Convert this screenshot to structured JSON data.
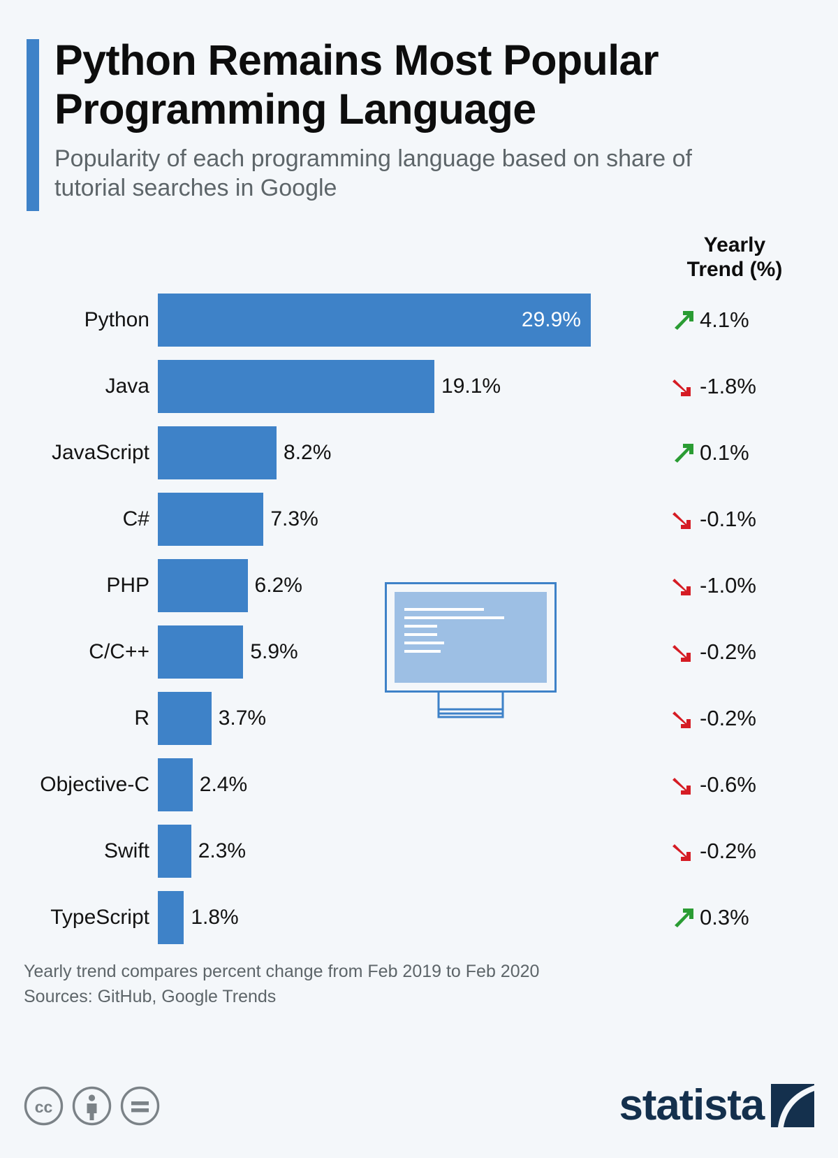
{
  "header": {
    "title": "Python Remains Most Popular Programming Language",
    "subtitle": "Popularity of each programming language based on share of tutorial searches in Google",
    "accent_color": "#3e82c8"
  },
  "trend_column": {
    "header_line1": "Yearly",
    "header_line2": "Trend (%)",
    "up_color": "#2a9c33",
    "down_color": "#d51c24"
  },
  "illustration": {
    "name": "computer-monitor-with-code",
    "frame_color": "#3e82c8",
    "screen_color": "#9dbfe4"
  },
  "footnotes": {
    "line1": "Yearly trend compares percent change from Feb 2019 to Feb 2020",
    "line2": "Sources: GitHub, Google Trends"
  },
  "footer": {
    "cc_icons": [
      "cc-icon",
      "attribution-person-icon",
      "no-derivatives-equals-icon"
    ],
    "logo_text": "statista",
    "logo_color": "#14304d"
  },
  "chart_data": {
    "type": "bar",
    "orientation": "horizontal",
    "title": "Python Remains Most Popular Programming Language",
    "subtitle": "Popularity of each programming language based on share of tutorial searches in Google",
    "xlabel": "",
    "ylabel": "",
    "xlim": [
      0,
      29.9
    ],
    "grid": false,
    "legend": false,
    "bar_color": "#3e82c8",
    "value_suffix": "%",
    "categories": [
      "Python",
      "Java",
      "JavaScript",
      "C#",
      "PHP",
      "C/C++",
      "R",
      "Objective-C",
      "Swift",
      "TypeScript"
    ],
    "values": [
      29.9,
      19.1,
      8.2,
      7.3,
      6.2,
      5.9,
      3.7,
      2.4,
      2.3,
      1.8
    ],
    "value_labels": [
      "29.9%",
      "19.1%",
      "8.2%",
      "7.3%",
      "6.2%",
      "5.9%",
      "3.7%",
      "2.4%",
      "2.3%",
      "1.8%"
    ],
    "series": [
      {
        "name": "Share of tutorial searches",
        "values": [
          29.9,
          19.1,
          8.2,
          7.3,
          6.2,
          5.9,
          3.7,
          2.4,
          2.3,
          1.8
        ]
      },
      {
        "name": "Yearly Trend (%)",
        "values": [
          4.1,
          -1.8,
          0.1,
          -0.1,
          -1.0,
          -0.2,
          -0.2,
          -0.6,
          -0.2,
          0.3
        ]
      }
    ],
    "rows": [
      {
        "label": "Python",
        "value": 29.9,
        "value_label": "29.9%",
        "label_inside": true,
        "trend": "4.1%",
        "trend_dir": "up"
      },
      {
        "label": "Java",
        "value": 19.1,
        "value_label": "19.1%",
        "label_inside": false,
        "trend": "-1.8%",
        "trend_dir": "down"
      },
      {
        "label": "JavaScript",
        "value": 8.2,
        "value_label": "8.2%",
        "label_inside": false,
        "trend": "0.1%",
        "trend_dir": "up"
      },
      {
        "label": "C#",
        "value": 7.3,
        "value_label": "7.3%",
        "label_inside": false,
        "trend": "-0.1%",
        "trend_dir": "down"
      },
      {
        "label": "PHP",
        "value": 6.2,
        "value_label": "6.2%",
        "label_inside": false,
        "trend": "-1.0%",
        "trend_dir": "down"
      },
      {
        "label": "C/C++",
        "value": 5.9,
        "value_label": "5.9%",
        "label_inside": false,
        "trend": "-0.2%",
        "trend_dir": "down"
      },
      {
        "label": "R",
        "value": 3.7,
        "value_label": "3.7%",
        "label_inside": false,
        "trend": "-0.2%",
        "trend_dir": "down"
      },
      {
        "label": "Objective-C",
        "value": 2.4,
        "value_label": "2.4%",
        "label_inside": false,
        "trend": "-0.6%",
        "trend_dir": "down"
      },
      {
        "label": "Swift",
        "value": 2.3,
        "value_label": "2.3%",
        "label_inside": false,
        "trend": "-0.2%",
        "trend_dir": "down"
      },
      {
        "label": "TypeScript",
        "value": 1.8,
        "value_label": "1.8%",
        "label_inside": false,
        "trend": "0.3%",
        "trend_dir": "up"
      }
    ]
  }
}
